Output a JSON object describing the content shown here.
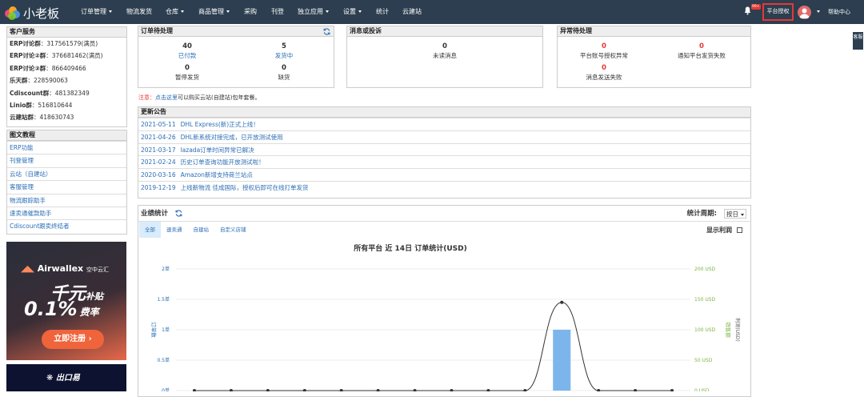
{
  "app": {
    "logo_text": "小老板"
  },
  "nav": {
    "items": [
      {
        "label": "订单管理",
        "caret": true
      },
      {
        "label": "物流发货",
        "caret": false
      },
      {
        "label": "仓库",
        "caret": true
      },
      {
        "label": "商品管理",
        "caret": true
      },
      {
        "label": "采购",
        "caret": false
      },
      {
        "label": "刊登",
        "caret": false
      },
      {
        "label": "独立应用",
        "caret": true
      },
      {
        "label": "设置",
        "caret": true
      },
      {
        "label": "统计",
        "caret": false
      },
      {
        "label": "云建站",
        "caret": false
      }
    ],
    "bell_badge": "99+",
    "platform_auth": "平台授权",
    "help": "帮助中心"
  },
  "side_tab": "客服",
  "customer_service": {
    "title": "客户服务",
    "rows": [
      {
        "name": "ERP讨论群",
        "value": "：317561579(满员)"
      },
      {
        "name": "ERP讨论②群",
        "value": "：376681462(满员)"
      },
      {
        "name": "ERP讨论③群",
        "value": "：866409466"
      },
      {
        "name": "乐天群",
        "value": "：228590063"
      },
      {
        "name": "Cdiscount群",
        "value": "：481382349"
      },
      {
        "name": "Linio群",
        "value": "：516810644"
      },
      {
        "name": "云建站群",
        "value": "：418630743"
      }
    ]
  },
  "tutorials": {
    "title": "图文教程",
    "items": [
      "ERP功能",
      "刊登管理",
      "云站（自建站）",
      "客服管理",
      "物流跟踪助手",
      "速卖通催款助手",
      "Cdiscount跟卖终结者"
    ]
  },
  "ads": {
    "airwallex": {
      "brand": "Airwallex",
      "brand_cn": "空中云汇",
      "line1": "千元",
      "line1b": "补贴",
      "line2": "0.1%",
      "line2b": "费率",
      "cta": "立即注册"
    },
    "chukou": {
      "brand": "出口易"
    }
  },
  "orders_pending": {
    "title": "订单待处理",
    "stats": [
      {
        "value": "40",
        "label": "已付款"
      },
      {
        "value": "5",
        "label": "发货中"
      },
      {
        "value": "0",
        "label": "暂停发货"
      },
      {
        "value": "0",
        "label": "缺货"
      }
    ]
  },
  "disputes": {
    "title": "消息或投诉",
    "stats": [
      {
        "value": "0",
        "label": "未读消息"
      }
    ]
  },
  "exceptions": {
    "title": "异常待处理",
    "stats": [
      {
        "value": "0",
        "label": "平台账号授权异常"
      },
      {
        "value": "0",
        "label": "通知平台发货失败"
      },
      {
        "value": "0",
        "label": "消息发送失败"
      }
    ]
  },
  "notice": {
    "prefix": "注意：",
    "link": "点击这里",
    "suffix": "可以购买云站(自建站)包年套餐。"
  },
  "announcements": {
    "title": "更新公告",
    "items": [
      {
        "date": "2021-05-11",
        "text": "DHL Express(新)正式上线！"
      },
      {
        "date": "2021-04-26",
        "text": "DHL新系统对接完成，已开放测试使用"
      },
      {
        "date": "2021-03-17",
        "text": "lazada订单时间异常已解决"
      },
      {
        "date": "2021-02-24",
        "text": "历史订单查询功能开放测试啦！"
      },
      {
        "date": "2020-03-16",
        "text": "Amazon新增支持荷兰站点"
      },
      {
        "date": "2019-12-19",
        "text": "上线新物流 佳成国际，授权后即可在线打单发货"
      }
    ]
  },
  "performance": {
    "title": "业绩统计",
    "period_label": "统计周期:",
    "period_value": "按日",
    "tabs": [
      "全部",
      "速卖通",
      "自建站",
      "自定义店铺"
    ],
    "show_profit": "显示利润"
  },
  "chart_data": {
    "type": "line",
    "title": "所有平台 近 14日 订单统计(USD)",
    "ylabel": "订单数",
    "y2label": "销售额",
    "y3label": "利润(USD)",
    "y_ticks": [
      "0单",
      "0.5单",
      "1单",
      "1.5单",
      "2单"
    ],
    "y2_ticks": [
      "0 USD",
      "50 USD",
      "100 USD",
      "150 USD",
      "200 USD"
    ],
    "ylim": [
      0,
      2
    ],
    "y2lim": [
      0,
      200
    ],
    "series": [
      {
        "name": "订单数",
        "kind": "bar",
        "values": [
          0,
          0,
          0,
          0,
          0,
          0,
          0,
          0,
          0,
          0,
          1,
          0,
          0,
          0
        ]
      },
      {
        "name": "销售额",
        "kind": "line",
        "values": [
          0,
          0,
          0,
          0,
          0,
          0,
          0,
          0,
          0,
          0,
          145,
          0,
          0,
          0
        ]
      }
    ],
    "colors": {
      "bar": "#7cb5ec",
      "line": "#333333",
      "y_axis": "#2a6db5",
      "y2_axis": "#7cb342"
    }
  }
}
